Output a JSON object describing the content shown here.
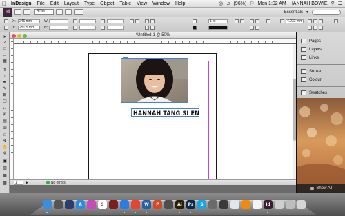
{
  "menubar": {
    "apple": "",
    "app_name": "InDesign",
    "items": [
      "File",
      "Edit",
      "Layout",
      "Type",
      "Object",
      "Table",
      "View",
      "Window",
      "Help"
    ],
    "battery": "(96%)",
    "clock": "Mon 1:02 AM",
    "user": "HANNAH BOWIE"
  },
  "appbar": {
    "logo": "Id",
    "zoom": "50%",
    "workspace": "Essentials"
  },
  "control": {
    "x_label": "X:",
    "x_value": "246 mm",
    "y_label": "Y:",
    "y_value": "251.5 mm",
    "w_label": "W:",
    "h_label": "H:",
    "stroke_weight": "1 pt",
    "pct_value": "4.233 mm"
  },
  "document": {
    "tab_title": "*Untitled-1 @ 50%",
    "name_text": "HANNAH TANG SI EN"
  },
  "status": {
    "page": "1",
    "errors": "No errors"
  },
  "panels": {
    "items": [
      {
        "label": "Pages",
        "icon": "pages-icon"
      },
      {
        "label": "Layers",
        "icon": "layers-icon"
      },
      {
        "label": "Links",
        "icon": "links-icon"
      },
      {
        "label": "Stroke",
        "icon": "stroke-icon"
      },
      {
        "label": "Colour",
        "icon": "colour-icon"
      },
      {
        "label": "Swatches",
        "icon": "swatches-icon"
      }
    ],
    "show_all": "Show All"
  },
  "dock": {
    "apps": [
      {
        "name": "finder-icon",
        "color": "#3b8de0",
        "label": ""
      },
      {
        "name": "launchpad-icon",
        "color": "#555555",
        "label": ""
      },
      {
        "name": "mission-control-icon",
        "color": "#2c3e6b",
        "label": ""
      },
      {
        "name": "appstore-icon",
        "color": "#2d8be8",
        "label": "A"
      },
      {
        "name": "itunes-icon",
        "color": "#c84ab6",
        "label": ""
      },
      {
        "name": "calendar-icon",
        "color": "#ffffff",
        "label": "9"
      },
      {
        "name": "photobooth-icon",
        "color": "#7a2020",
        "label": ""
      },
      {
        "name": "safari-icon",
        "color": "#2b7de0",
        "label": ""
      },
      {
        "name": "chrome-icon",
        "color": "#e6442f",
        "label": ""
      },
      {
        "name": "word-icon",
        "color": "#2a5ca8",
        "label": "W"
      },
      {
        "name": "powerpoint-icon",
        "color": "#d24a26",
        "label": "P"
      },
      {
        "name": "vmware-icon",
        "color": "#4d4d4d",
        "label": ""
      },
      {
        "name": "illustrator-icon",
        "color": "#2e1d05",
        "label": "Ai"
      },
      {
        "name": "photoshop-icon",
        "color": "#0a2a45",
        "label": "Ps"
      },
      {
        "name": "skype-icon",
        "color": "#1aa3e8",
        "label": "S"
      },
      {
        "name": "tools-icon",
        "color": "#6b6b6b",
        "label": ""
      },
      {
        "name": "chess-icon",
        "color": "#3a3a3a",
        "label": ""
      },
      {
        "name": "preview-icon",
        "color": "#dfe6ee",
        "label": ""
      },
      {
        "name": "vlc-icon",
        "color": "#f08a0c",
        "label": ""
      },
      {
        "name": "pdf-icon",
        "color": "#f3f3f3",
        "label": ""
      },
      {
        "name": "indesign-icon",
        "color": "#3b1a33",
        "label": "Id"
      },
      {
        "name": "downloads-icon",
        "color": "#cfcfcf",
        "label": ""
      },
      {
        "name": "documents-icon",
        "color": "#bdbdbd",
        "label": ""
      },
      {
        "name": "trash-icon",
        "color": "#d5d5d5",
        "label": ""
      }
    ]
  }
}
